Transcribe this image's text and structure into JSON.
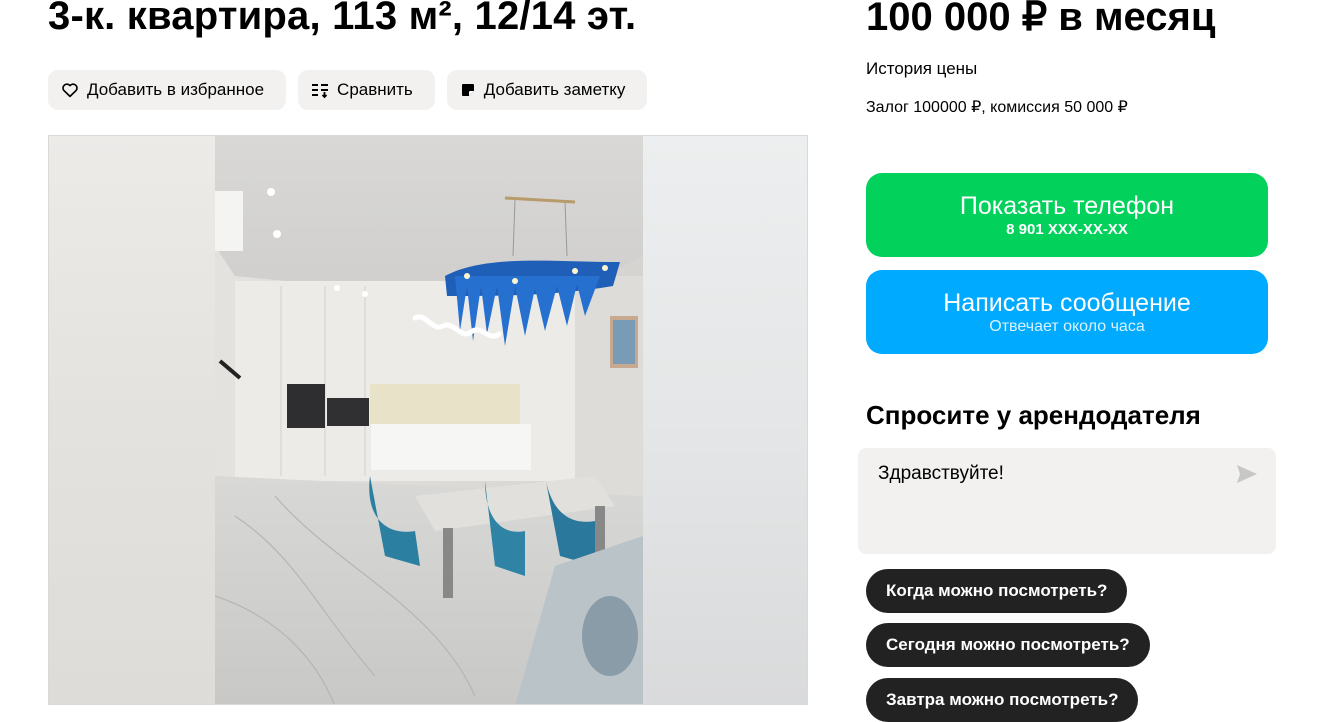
{
  "listing": {
    "title": "3-к. квартира, 113 м², 12/14 эт.",
    "price": "100 000 ₽ в месяц",
    "price_history": "История цены",
    "deposit_commission": "Залог 100000 ₽, комиссия 50 000 ₽"
  },
  "actions": {
    "favorite": {
      "label": "Добавить в избранное",
      "icon": "heart-icon"
    },
    "compare": {
      "label": "Сравнить",
      "icon": "compare-icon"
    },
    "note": {
      "label": "Добавить заметку",
      "icon": "note-icon"
    }
  },
  "contact": {
    "phone_button": {
      "label": "Показать телефон",
      "sub": "8 901 XXX-XX-XX"
    },
    "message_button": {
      "label": "Написать сообщение",
      "sub": "Отвечает около часа"
    }
  },
  "ask": {
    "title": "Спросите у арендодателя",
    "message": "Здравствуйте!",
    "quick_questions": [
      "Когда можно посмотреть?",
      "Сегодня можно посмотреть?",
      "Завтра можно посмотреть?"
    ]
  },
  "colors": {
    "phone_button": "#02d15c",
    "message_button": "#00aaff",
    "chip": "#222222",
    "secondary_bg": "#f2f1f0"
  }
}
